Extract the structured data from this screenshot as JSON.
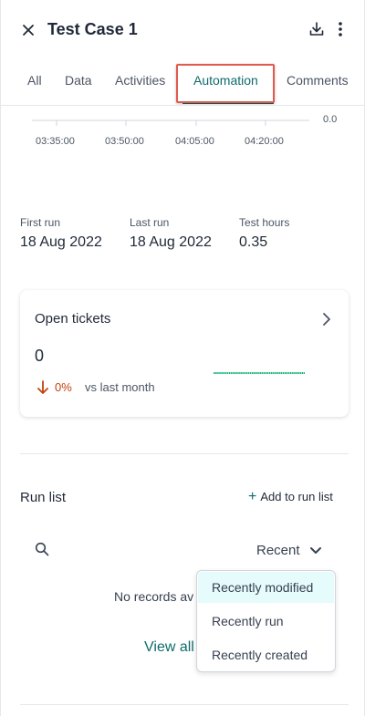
{
  "header": {
    "title": "Test Case 1"
  },
  "tabs": [
    {
      "label": "All"
    },
    {
      "label": "Data"
    },
    {
      "label": "Activities"
    },
    {
      "label": "Automation"
    },
    {
      "label": "Comments"
    }
  ],
  "active_tab": "Automation",
  "chart_fragment": {
    "x_ticks": [
      "03:35:00",
      "03:50:00",
      "04:05:00",
      "04:20:00"
    ],
    "y_tick_partial": "0.0"
  },
  "stats": [
    {
      "label": "First run",
      "value": "18 Aug 2022"
    },
    {
      "label": "Last run",
      "value": "18 Aug 2022"
    },
    {
      "label": "Test hours",
      "value": "0.35"
    }
  ],
  "open_tickets": {
    "title": "Open tickets",
    "count": "0",
    "change": "0%",
    "comparison": "vs last month"
  },
  "run_list": {
    "title": "Run list",
    "add_label": "Add to run list",
    "sort_label": "Recent",
    "empty_text": "No records av",
    "view_all": "View all",
    "sort_options": [
      "Recently modified",
      "Recently run",
      "Recently created"
    ],
    "selected_option": "Recently modified"
  },
  "colors": {
    "accent": "#0f6b6b",
    "negative": "#c2410c",
    "sparkline": "#16b877",
    "highlight": "#e05a4f"
  }
}
